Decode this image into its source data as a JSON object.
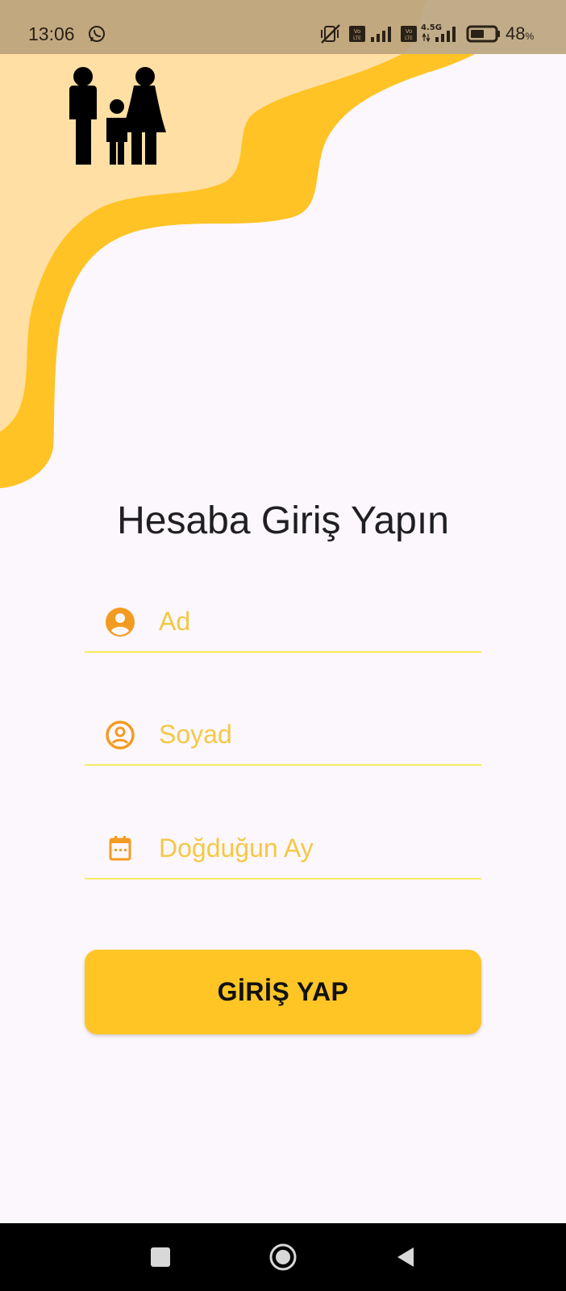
{
  "status_bar": {
    "time": "13:06",
    "battery_text": "48",
    "battery_unit": "%",
    "icons": [
      "whatsapp-icon",
      "vibrate-off-icon",
      "volte-icon",
      "signal-icon",
      "volte-icon",
      "4.5g-icon",
      "signal-icon",
      "battery-icon"
    ],
    "network_label": "4.5G",
    "volte_label": "Vo LTE"
  },
  "header": {
    "logo_icon": "family-icon",
    "background_colors": {
      "light": "#ffdfa3",
      "dark": "#ffc325"
    }
  },
  "login": {
    "title": "Hesaba Giriş Yapın",
    "fields": [
      {
        "name": "first-name",
        "icon": "account-circle-icon",
        "placeholder": "Ad",
        "value": ""
      },
      {
        "name": "last-name",
        "icon": "account-circle-outline-icon",
        "placeholder": "Soyad",
        "value": ""
      },
      {
        "name": "birth-month",
        "icon": "calendar-icon",
        "placeholder": "Doğduğun Ay",
        "value": ""
      }
    ],
    "submit_label": "GİRİŞ YAP",
    "accent": "#f3a12b",
    "button_color": "#ffc525",
    "underline_color": "#f6eb62"
  },
  "nav": {
    "buttons": [
      "recent-apps-icon",
      "home-icon",
      "back-icon"
    ]
  }
}
